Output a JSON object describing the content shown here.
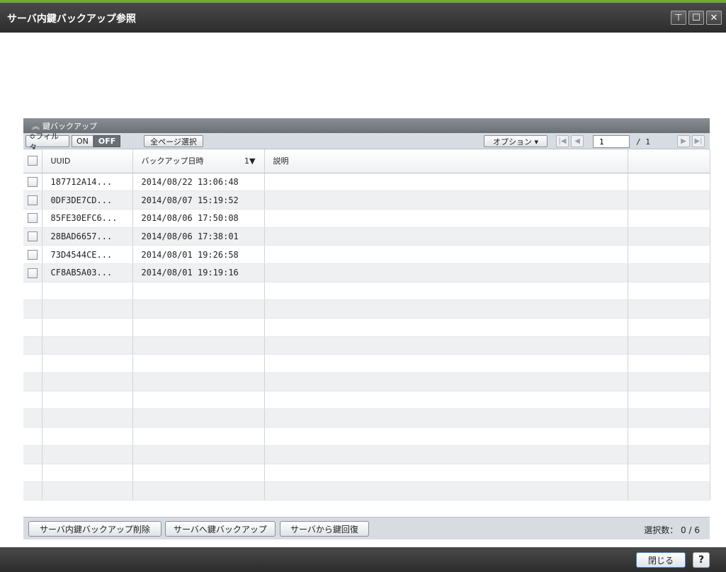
{
  "window": {
    "title": "サーバ内鍵バックアップ参照",
    "pin_icon": "pin-icon",
    "maximize_icon": "maximize-icon",
    "close_icon": "close-icon"
  },
  "panel": {
    "title": "鍵バックアップ",
    "collapse_icon": "chevron-up-double-icon"
  },
  "toolbar": {
    "filter_label": "≎フィルタ",
    "toggle_on": "ON",
    "toggle_off": "OFF",
    "select_all_pages": "全ページ選択",
    "options_label": "オプション ▾",
    "page_current": "1",
    "page_total": "/ 1"
  },
  "table": {
    "headers": {
      "uuid": "UUID",
      "date": "バックアップ日時",
      "sort": "1▼",
      "desc": "説明"
    },
    "rows": [
      {
        "uuid": "187712A14...",
        "date": "2014/08/22 13:06:48",
        "desc": ""
      },
      {
        "uuid": "0DF3DE7CD...",
        "date": "2014/08/07 15:19:52",
        "desc": ""
      },
      {
        "uuid": "85FE30EFC6...",
        "date": "2014/08/06 17:50:08",
        "desc": ""
      },
      {
        "uuid": "28BAD6657...",
        "date": "2014/08/06 17:38:01",
        "desc": ""
      },
      {
        "uuid": "73D4544CE...",
        "date": "2014/08/01 19:26:58",
        "desc": ""
      },
      {
        "uuid": "CF8AB5A03...",
        "date": "2014/08/01 19:19:16",
        "desc": ""
      }
    ]
  },
  "footer": {
    "delete_button": "サーバ内鍵バックアップ削除",
    "backup_button": "サーバへ鍵バックアップ",
    "restore_button": "サーバから鍵回復",
    "selection_count": "選択数： 0  /  6"
  },
  "bottom": {
    "close_button": "閉じる",
    "help_button": "?"
  }
}
